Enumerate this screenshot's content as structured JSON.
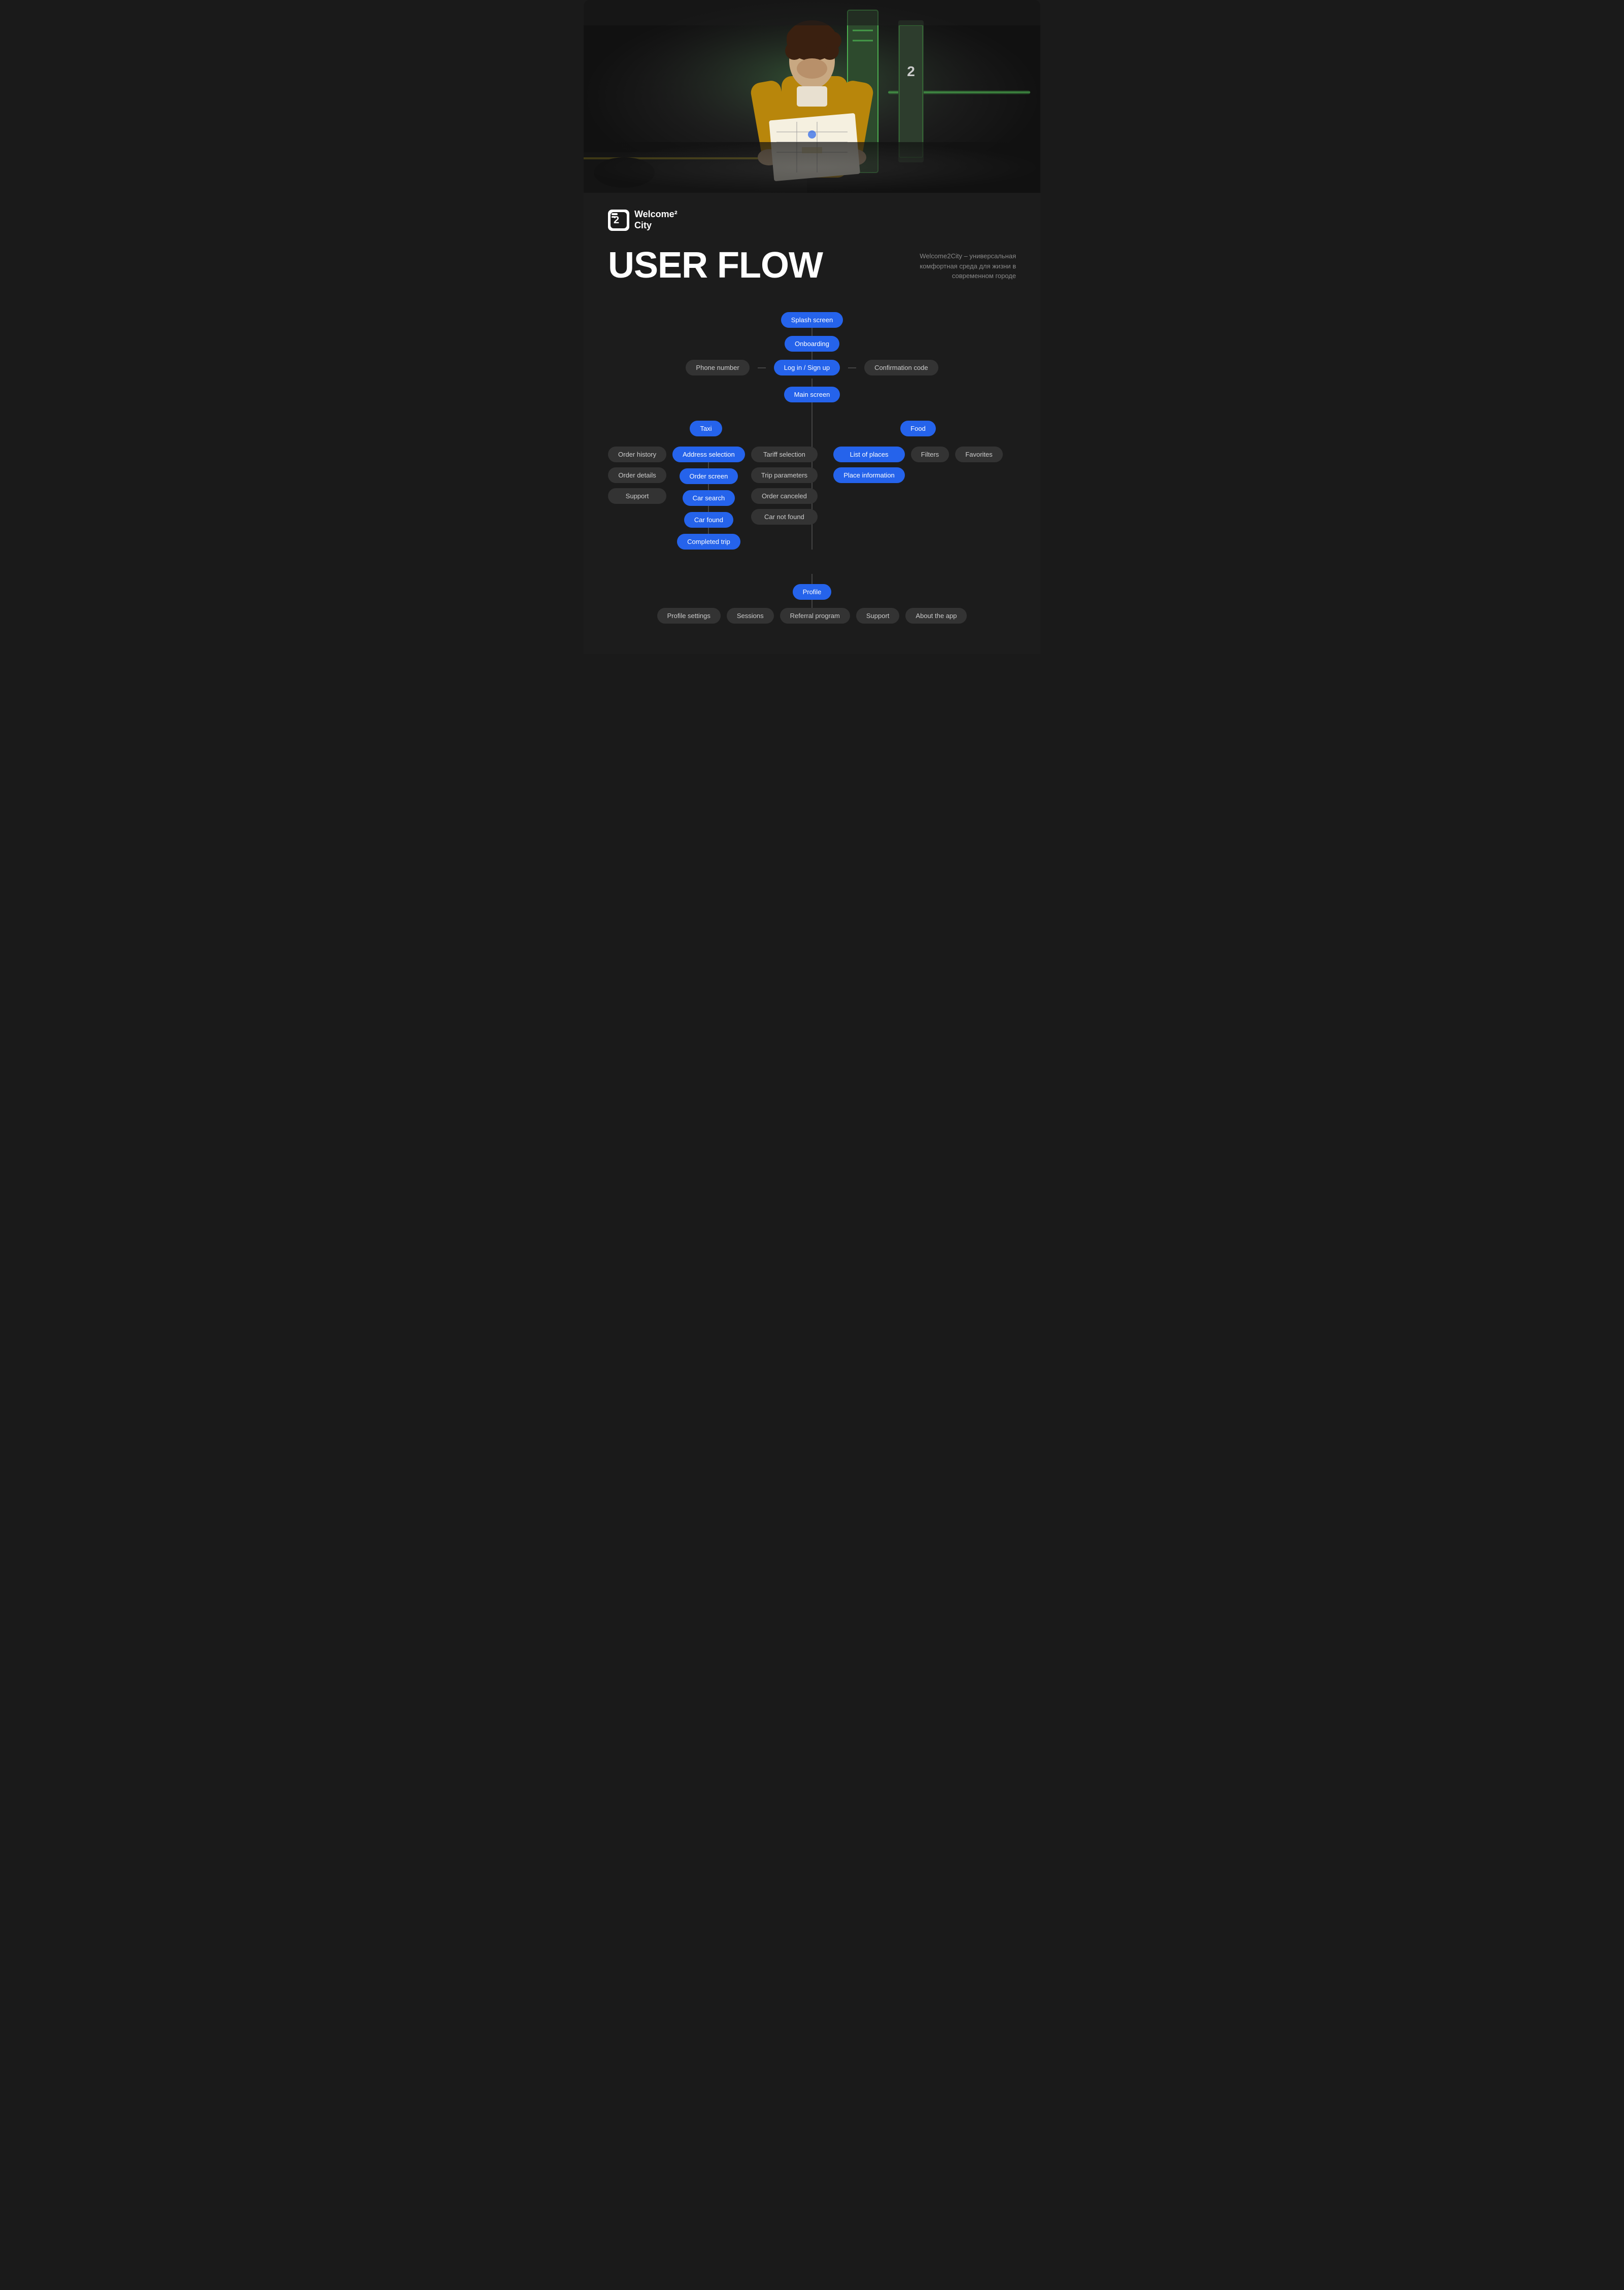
{
  "hero": {
    "alt": "Person reading a map next to a car"
  },
  "logo": {
    "icon": "2",
    "name": "Welcome²",
    "subname": "City"
  },
  "header": {
    "title": "USER FLOW",
    "tagline": "Welcome2City – универсальная комфортная среда для жизни в современном городе"
  },
  "flow": {
    "top_nodes": [
      {
        "id": "splash",
        "label": "Splash screen",
        "type": "blue"
      },
      {
        "id": "onboarding",
        "label": "Onboarding",
        "type": "blue"
      },
      {
        "id": "login",
        "label": "Log in / Sign up",
        "type": "blue"
      },
      {
        "id": "phone",
        "label": "Phone number",
        "type": "dark"
      },
      {
        "id": "confirm",
        "label": "Confirmation code",
        "type": "dark"
      },
      {
        "id": "main",
        "label": "Main screen",
        "type": "blue"
      }
    ],
    "taxi": {
      "header": {
        "label": "Taxi",
        "type": "blue"
      },
      "left": [
        {
          "label": "Order history",
          "type": "dark"
        },
        {
          "label": "Order details",
          "type": "dark"
        },
        {
          "label": "Support",
          "type": "dark"
        }
      ],
      "center": [
        {
          "label": "Address selection",
          "type": "blue"
        },
        {
          "label": "Order screen",
          "type": "blue"
        },
        {
          "label": "Car search",
          "type": "blue"
        },
        {
          "label": "Car found",
          "type": "blue"
        },
        {
          "label": "Completed trip",
          "type": "blue"
        }
      ],
      "right": [
        {
          "label": "Tariff selection",
          "type": "dark"
        },
        {
          "label": "Trip parameters",
          "type": "dark"
        },
        {
          "label": "Order canceled",
          "type": "dark"
        },
        {
          "label": "Car not found",
          "type": "dark"
        }
      ]
    },
    "food": {
      "header": {
        "label": "Food",
        "type": "blue"
      },
      "cols": [
        [
          {
            "label": "List of places",
            "type": "blue"
          },
          {
            "label": "Place information",
            "type": "blue"
          }
        ],
        [
          {
            "label": "Filters",
            "type": "dark"
          }
        ],
        [
          {
            "label": "Favorites",
            "type": "dark"
          }
        ]
      ]
    },
    "profile": {
      "header": {
        "label": "Profile",
        "type": "blue"
      },
      "children": [
        {
          "label": "Profile settings",
          "type": "dark"
        },
        {
          "label": "Sessions",
          "type": "dark"
        },
        {
          "label": "Referral program",
          "type": "dark"
        },
        {
          "label": "Support",
          "type": "dark"
        },
        {
          "label": "About the app",
          "type": "dark"
        }
      ]
    }
  }
}
